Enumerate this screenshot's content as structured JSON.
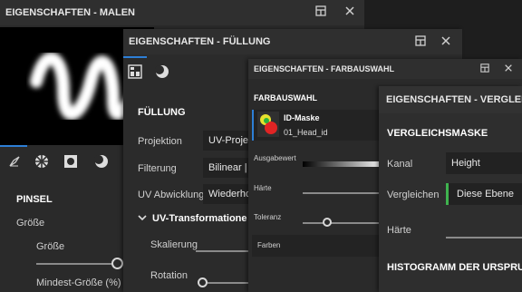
{
  "panel_malen": {
    "title": "EIGENSCHAFTEN - MALEN",
    "section_title": "PINSEL",
    "label_size_group": "Größe",
    "label_size": "Größe",
    "label_min_size": "Mindest-Größe (%)",
    "tabs": [
      "brush-tool-icon",
      "checker-ball-icon",
      "square-dot-icon",
      "sphere-icon"
    ]
  },
  "panel_fuellung": {
    "title": "EIGENSCHAFTEN - FÜLLUNG",
    "section_title": "FÜLLUNG",
    "label_projektion": "Projektion",
    "value_projektion": "UV-Projek",
    "label_filterung": "Filterung",
    "value_filterung": "Bilinear | ",
    "label_uv_abwicklung": "UV Abwicklung",
    "value_uv_abwicklung": "Wiederho",
    "subsection": "UV-Transformatione",
    "label_skalierung": "Skalierung",
    "label_rotation": "Rotation"
  },
  "panel_farbauswahl": {
    "title": "EIGENSCHAFTEN - FARBAUSWAHL",
    "section_title": "FARBAUSWAHL",
    "mask_name": "ID-Maske",
    "mask_file": "01_Head_id",
    "label_ausgabewert": "Ausgabewert",
    "label_haerte": "Härte",
    "label_toleranz": "Toleranz",
    "label_farben": "Farben"
  },
  "panel_vergleich": {
    "title": "EIGENSCHAFTEN - VERGLEIC",
    "section_title": "VERGLEICHSMASKE",
    "label_kanal": "Kanal",
    "value_kanal": "Height",
    "label_vergleichen": "Vergleichen",
    "value_vergleichen": "Diese Ebene",
    "label_haerte": "Härte",
    "section2_title": "HISTOGRAMM DER URSPRU"
  },
  "colors": {
    "accent_blue": "#2d7fd6",
    "accent_green": "#3fb34f",
    "panel_bg": "#2b2b2b",
    "titlebar_bg": "#2f2f2f"
  }
}
